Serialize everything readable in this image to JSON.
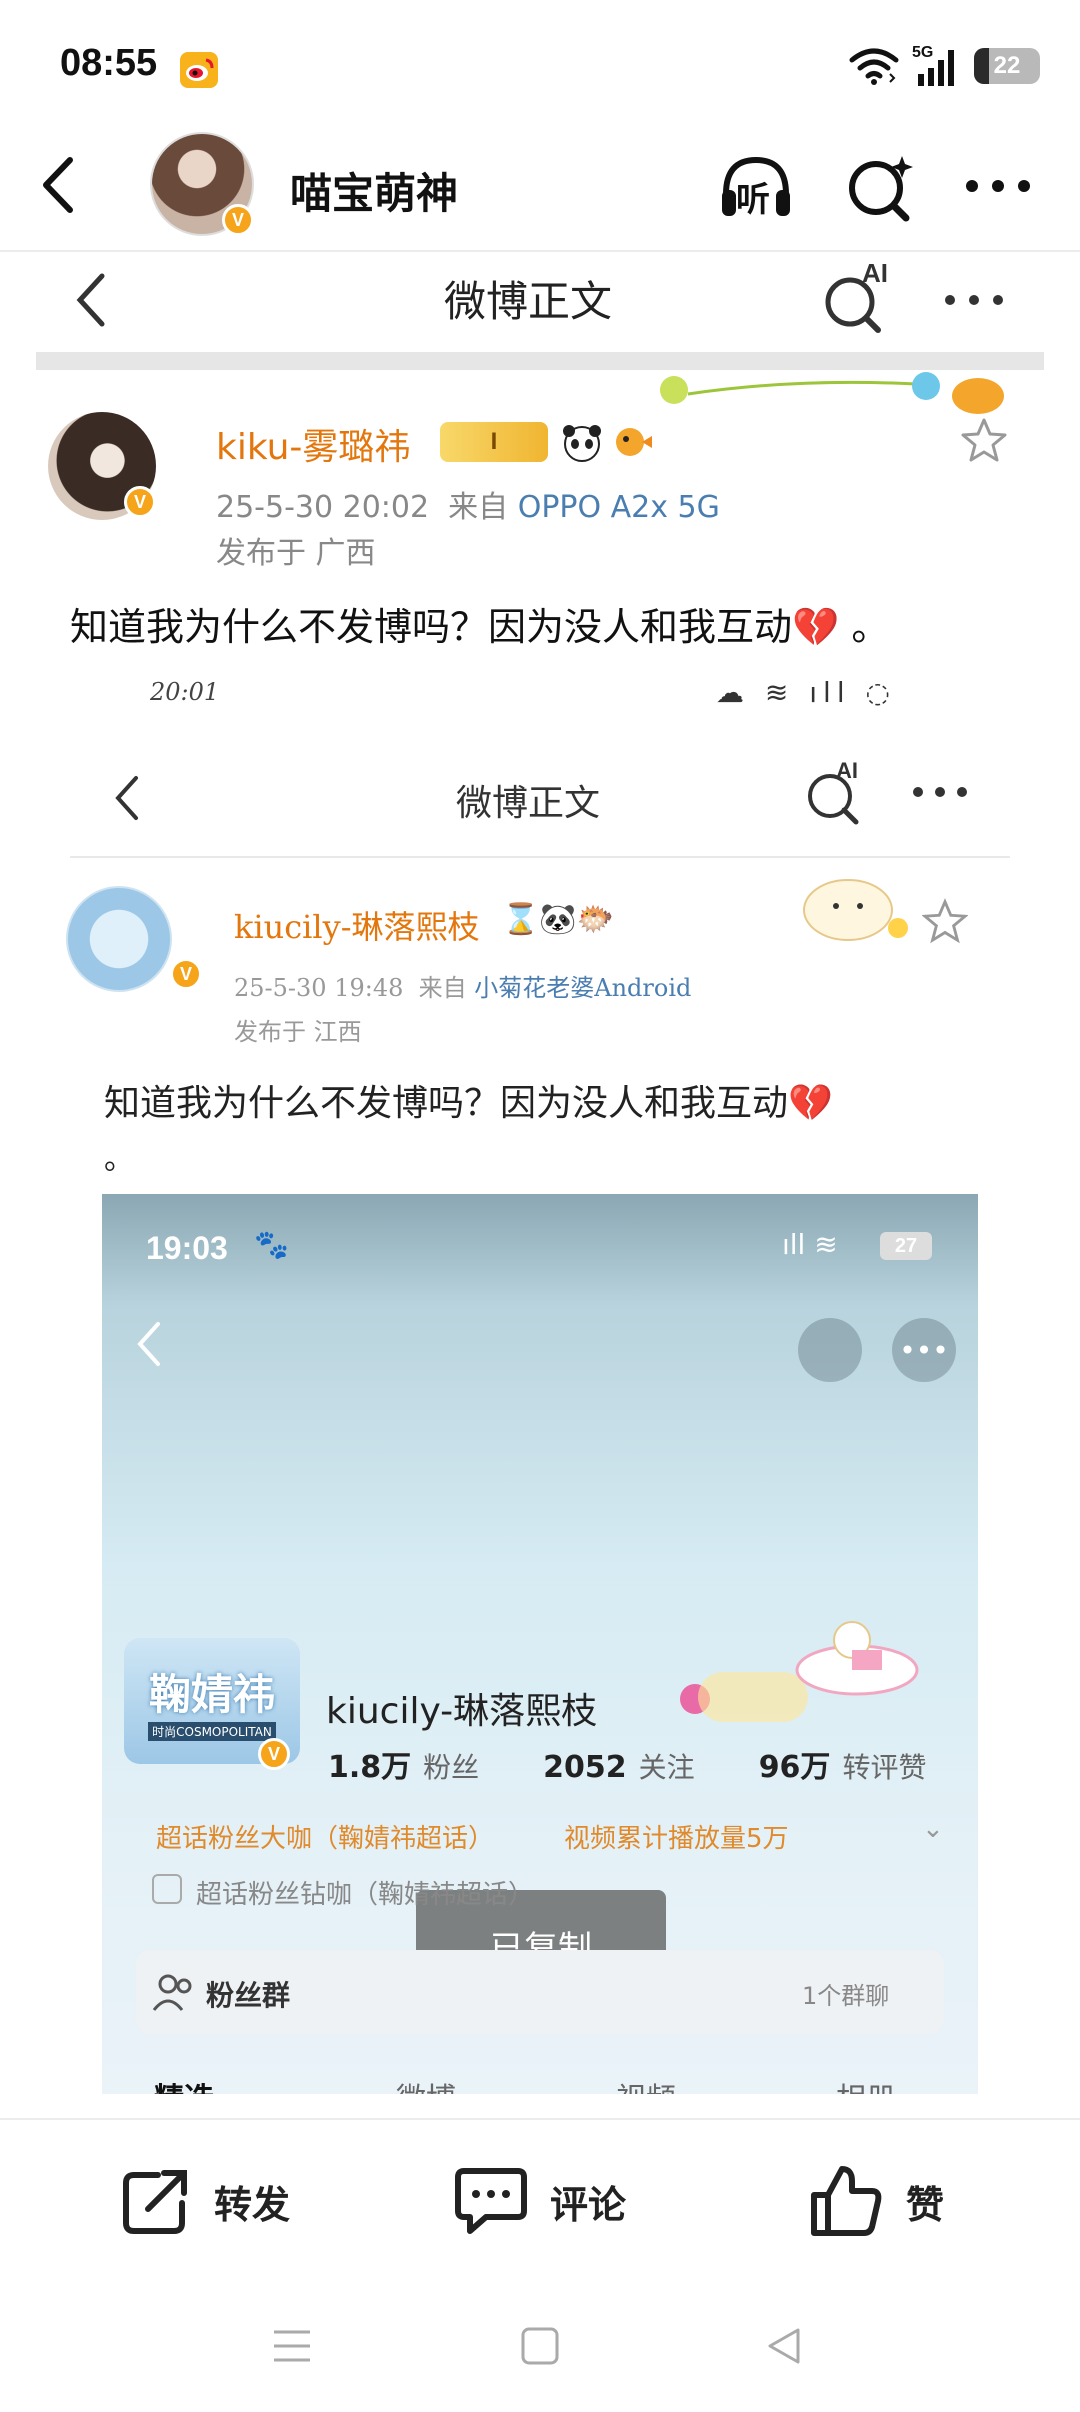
{
  "status_bar": {
    "time": "08:55",
    "battery": "22",
    "network": "5G"
  },
  "header": {
    "username": "喵宝萌神",
    "listen_label": "听"
  },
  "post": {
    "nav_title": "微博正文",
    "ai_label": "AI",
    "author": "kiku-雾璐祎",
    "level_badge": "I",
    "date": "25-5-30 20:02",
    "from_label": "来自",
    "source": "OPPO A2x 5G",
    "location": "发布于 广西",
    "text": "知道我为什么不发博吗？因为没人和我互动💔 。"
  },
  "embedded_post": {
    "time": "20:01",
    "nav_title": "微博正文",
    "ai_label": "AI",
    "author": "kiucily-琳落熙枝",
    "date": "25-5-30 19:48",
    "from_label": "来自",
    "source": "小菊花老婆Android",
    "location": "发布于 江西",
    "text": "知道我为什么不发博吗？因为没人和我互动💔",
    "text_tail": "。"
  },
  "profile_screenshot": {
    "time": "19:03",
    "battery": "27",
    "avatar_text": "鞠婧祎",
    "avatar_subtext": "时尚COSMOPOLITAN",
    "name": "kiucily-琳落熙枝",
    "followers_num": "1.8万",
    "followers_label": "粉丝",
    "following_num": "2052",
    "following_label": "关注",
    "likes_num": "96万",
    "likes_label": "转评赞",
    "tag_left": "超话粉丝大咖（鞠婧祎超话）",
    "tag_right": "视频累计播放量5万",
    "tag_second": "超话粉丝钻咖（鞠婧祎超话）",
    "fans_group": "粉丝群",
    "group_count": "1个群聊",
    "tabs": [
      "精选",
      "微博",
      "视频",
      "相册"
    ],
    "toast": "已复制"
  },
  "actions": {
    "repost": "转发",
    "comment": "评论",
    "like": "赞"
  }
}
